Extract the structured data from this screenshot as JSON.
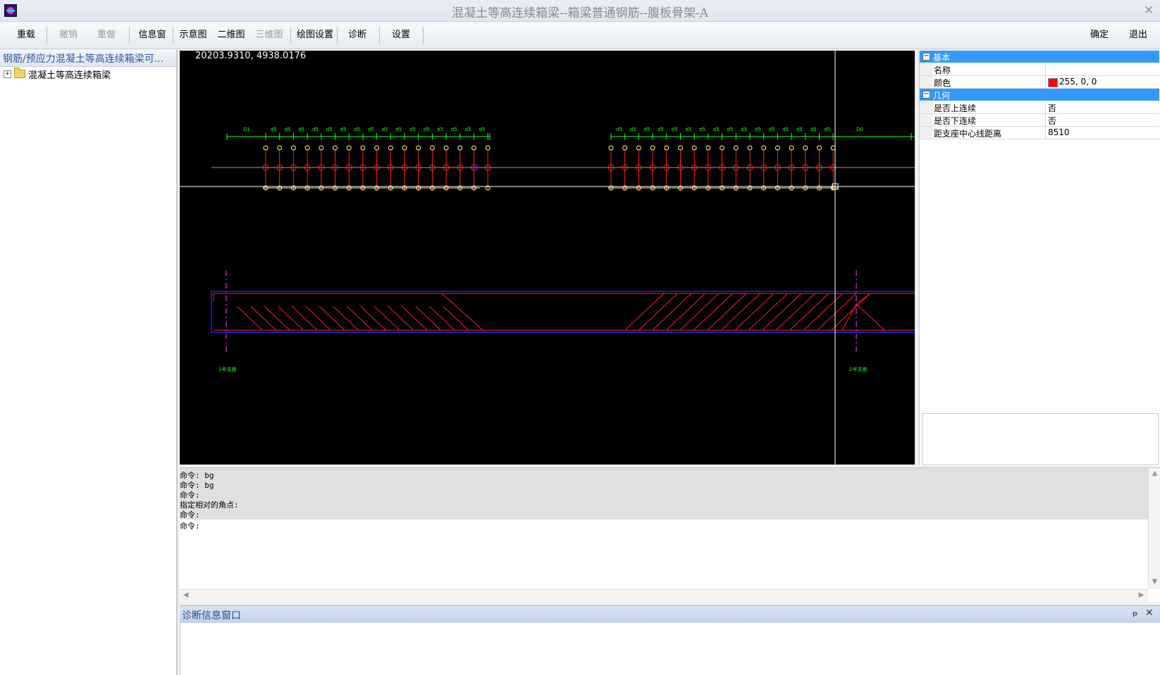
{
  "window": {
    "title": "混凝土等高连续箱梁--箱梁普通钢筋--腹板骨架-A",
    "close": "×"
  },
  "toolbar": {
    "reload": "重载",
    "undo": "撤销",
    "redo": "重做",
    "info": "信息窗",
    "schematic": "示意图",
    "view2d": "二维图",
    "view3d": "三维图",
    "draw_settings": "绘图设置",
    "diagnose": "诊断",
    "settings": "设置",
    "ok": "确定",
    "exit": "退出"
  },
  "tree": {
    "header": "钢筋/预应力混凝土等高连续箱梁可...",
    "expander": "+",
    "root_label": "混凝土等高连续箱梁"
  },
  "canvas": {
    "coord_readout": "20203.9310, 4938.0176",
    "dim_left_start": "D1",
    "dim_right_end": "D0",
    "dim_segment": "d5",
    "support1": "1号支座",
    "support2": "2号支座"
  },
  "properties": {
    "cat_basic": "基本",
    "cat_geometry": "几何",
    "toggle": "−",
    "rows": [
      {
        "key": "名称",
        "value": ""
      },
      {
        "key": "颜色",
        "value": "255, 0, 0",
        "color": "#ff0000"
      },
      {
        "key": "是否上连续",
        "value": "否"
      },
      {
        "key": "是否下连续",
        "value": "否"
      },
      {
        "key": "距支座中心线距离",
        "value": "8510"
      }
    ]
  },
  "command": {
    "lines": [
      "命令: bg",
      "命令: bg",
      "命令:",
      "指定相对的角点:",
      "命令:",
      "命令:"
    ]
  },
  "diagnostics": {
    "title": "诊断信息窗口",
    "pin": "ᵽ",
    "close": "✕"
  },
  "colors": {
    "canvas_bg": "#000000",
    "rebar_red": "#ff2020",
    "dim_green": "#20ff20",
    "node_yellow": "#ffff66",
    "outline_blue": "#2020ff",
    "axis_magenta": "#ff40ff",
    "selection_blue": "#3399ff"
  }
}
